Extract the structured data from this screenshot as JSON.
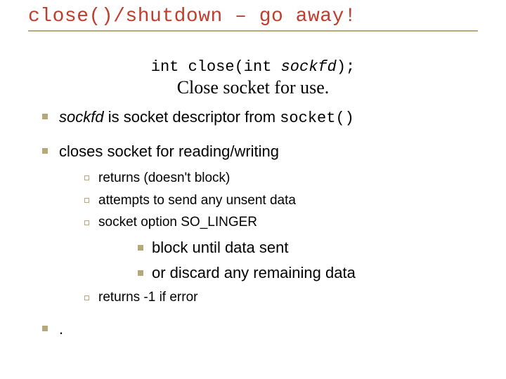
{
  "title": "close()/shutdown – go away!",
  "code_line_prefix": "int close(int ",
  "code_line_arg": "sockfd",
  "code_line_suffix": ");",
  "subheading": "Close socket for use.",
  "bullets": {
    "b1_prefix_italic": "sockfd",
    "b1_mid": " is socket descriptor from ",
    "b1_mono": "socket()",
    "b2": "closes socket for reading/writing",
    "b2_sub": {
      "s1": "returns (doesn't block)",
      "s2": "attempts to send any unsent data",
      "s3": "socket option SO_LINGER",
      "s3_sub": {
        "t1": "block until data sent",
        "t2": "or discard any remaining data"
      },
      "s4": "returns -1 if error"
    },
    "b3": "."
  }
}
